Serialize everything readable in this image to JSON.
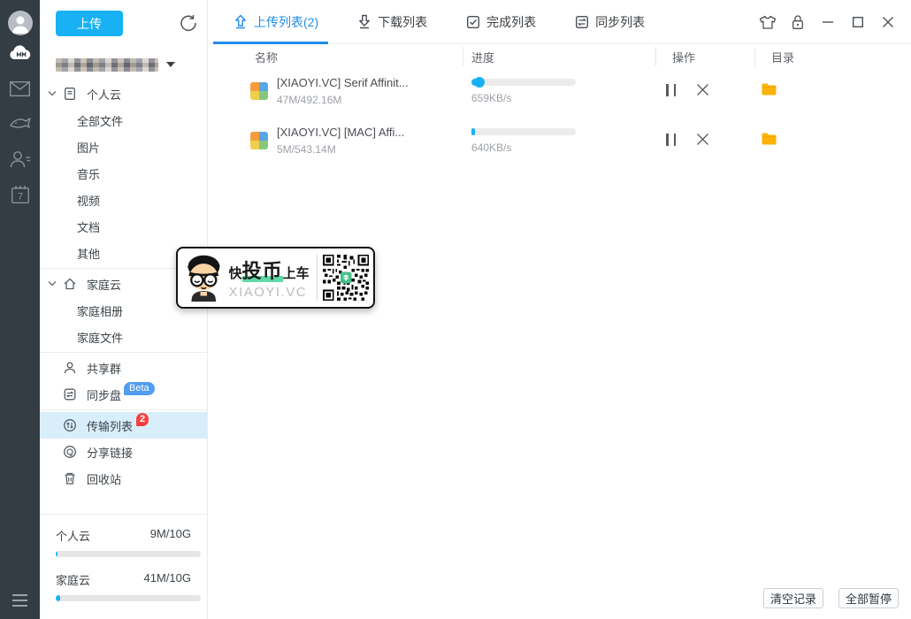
{
  "rail": {
    "icons": [
      "user-avatar",
      "caiyun-cloud",
      "mail",
      "fish",
      "contacts",
      "calendar-7",
      "menu"
    ]
  },
  "sidebar": {
    "upload_button": "上传",
    "tree": [
      {
        "label": "个人云"
      },
      {
        "label": "全部文件"
      },
      {
        "label": "图片"
      },
      {
        "label": "音乐"
      },
      {
        "label": "视频"
      },
      {
        "label": "文档"
      },
      {
        "label": "其他"
      },
      {
        "label": "家庭云"
      },
      {
        "label": "家庭相册"
      },
      {
        "label": "家庭文件"
      },
      {
        "label": "共享群"
      },
      {
        "label": "同步盘",
        "badge": "Beta"
      },
      {
        "label": "传输列表",
        "badge": "2",
        "selected": true
      },
      {
        "label": "分享链接"
      },
      {
        "label": "回收站"
      }
    ],
    "quota": [
      {
        "label": "个人云",
        "value": "9M/10G",
        "fill_pct": 1
      },
      {
        "label": "家庭云",
        "value": "41M/10G",
        "fill_pct": 3
      }
    ]
  },
  "tabs": [
    {
      "label": "上传列表(2)",
      "active": true
    },
    {
      "label": "下载列表"
    },
    {
      "label": "完成列表"
    },
    {
      "label": "同步列表"
    }
  ],
  "table": {
    "headers": [
      "名称",
      "进度",
      "操作",
      "目录"
    ],
    "rows": [
      {
        "name": "[XIAOYI.VC] Serif Affinit...",
        "size": "47M/492.16M",
        "speed": "659KB/s",
        "progress_pct": 8
      },
      {
        "name": "[XIAOYI.VC] [MAC] Affi...",
        "size": "5M/543.14M",
        "speed": "640KB/s",
        "progress_pct": 3
      }
    ]
  },
  "watermark": {
    "line1_pre": "快",
    "line1_em": "投币",
    "line1_post": "上车",
    "line2": "XIAOYI.VC"
  },
  "footer": {
    "clear": "清空记录",
    "pause_all": "全部暂停"
  },
  "colors": {
    "accent_cyan": "#18b2f4",
    "tab_blue": "#1f8ceb",
    "badge_red": "#fa3e3e",
    "beta_blue": "#509df1",
    "folder_yellow": "#fcb308",
    "rail_dark": "#343d44",
    "selected_bg": "#d8eefb"
  }
}
